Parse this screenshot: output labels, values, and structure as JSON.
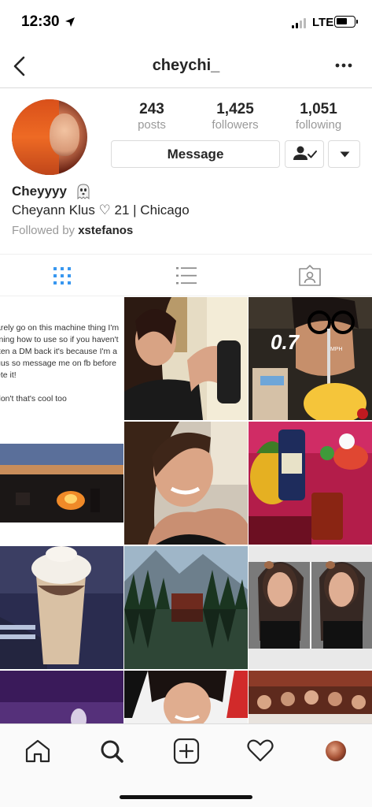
{
  "status_bar": {
    "time": "12:30",
    "carrier": "LTE"
  },
  "header": {
    "title": "cheychi_"
  },
  "profile": {
    "stats": [
      {
        "value": "243",
        "label": "posts"
      },
      {
        "value": "1,425",
        "label": "followers"
      },
      {
        "value": "1,051",
        "label": "following"
      }
    ],
    "message_label": "Message",
    "display_name": "Cheyyyy",
    "bio": "Cheyann Klus ♡ 21 | Chicago",
    "followed_by_prefix": "Followed by ",
    "followed_by_user": "xstefanos"
  },
  "grid": {
    "text_post_lines": [
      "arely go on this machine thing I'm",
      "rning how to use so if you haven't",
      "tten a DM back it's because I'm a",
      "gus so message me on fb before",
      "ete it!",
      "",
      "don't that's cool too"
    ],
    "speed_overlay": "0.7",
    "speed_unit": "MPH"
  },
  "icons": {
    "back": "chevron-left-icon",
    "more": "more-dots-icon",
    "ghost": "ghost-emoji-icon",
    "grid_tab": "grid-icon",
    "list_tab": "list-icon",
    "tagged_tab": "tagged-icon",
    "home": "home-icon",
    "search": "search-icon",
    "add": "add-post-icon",
    "activity": "heart-icon"
  },
  "colors": {
    "accent": "#3897f0",
    "text": "#262626",
    "muted": "#999999",
    "border": "#dbdbdb"
  }
}
